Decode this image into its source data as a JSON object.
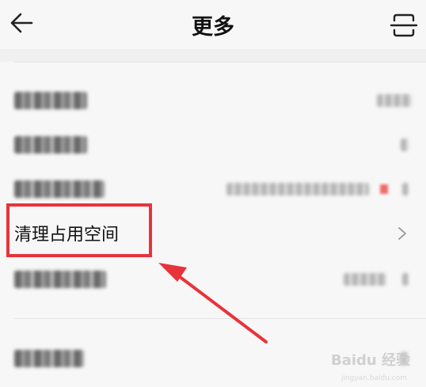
{
  "header": {
    "title": "更多",
    "back_icon": "back-arrow-icon",
    "scan_icon": "scan-icon"
  },
  "settings": {
    "items": [
      {
        "label": "清理占用空间",
        "trailing_icon": "chevron-right-icon"
      }
    ]
  },
  "annotation": {
    "box_color": "#e8333a",
    "arrow_color": "#e8333a"
  },
  "watermark": {
    "text": "Baidu 经验",
    "sub": "jingyan.baidu.com"
  }
}
